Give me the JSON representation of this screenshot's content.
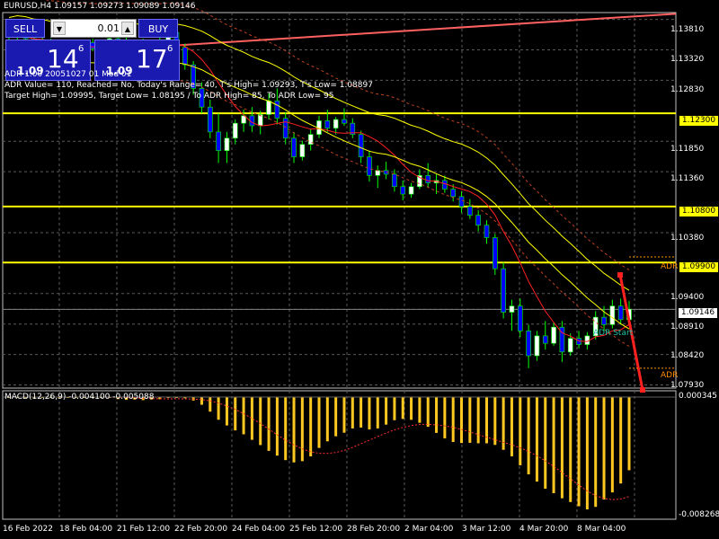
{
  "title": "EURUSD,H4  1.09157 1.09273 1.09089 1.09146",
  "trade_panel": {
    "sell_label": "SELL",
    "buy_label": "BUY",
    "lot_value": "0.01",
    "bid_prefix": "1.09",
    "bid_big": "14",
    "bid_sup": "6",
    "ask_prefix": "1.09",
    "ask_big": "17",
    "ask_sup": "6"
  },
  "info_lines": [
    "ADR 1.00 20051027 01 Mod 01",
    "ADR Value= 110, Reached= No, Today's Range= 40, T's High= 1.09293, T's Low= 1.08897",
    "Target High= 1.09995, Target Low= 1.08195 / To ADR High= 85, To ADR Low= 95"
  ],
  "price_axis": [
    "1.13810",
    "1.13320",
    "1.12830",
    "1.12300",
    "1.11850",
    "1.11360",
    "1.10800",
    "1.10380",
    "1.09900",
    "1.09400",
    "1.09146",
    "1.08910",
    "1.08420",
    "1.07930"
  ],
  "highlight_levels": [
    "1.12300",
    "1.10800",
    "1.09900"
  ],
  "current_price": "1.09146",
  "labels": {
    "adr_start": "ADR Start",
    "adr_high": "ADR",
    "adr_low": "ADR"
  },
  "macd": {
    "title": "MACD(12,26,9) -0.004100 -0.005088",
    "axis_top": "0.000345",
    "axis_bottom": "-0.008268"
  },
  "time_axis": [
    "16 Feb 2022",
    "18 Feb 04:00",
    "21 Feb 12:00",
    "22 Feb 20:00",
    "24 Feb 04:00",
    "25 Feb 12:00",
    "28 Feb 20:00",
    "2 Mar 04:00",
    "3 Mar 12:00",
    "4 Mar 20:00",
    "8 Mar 04:00"
  ],
  "colors": {
    "background": "#000000",
    "grid": "#5a5a5a",
    "bull_candle": "#ffffff",
    "bear_candle": "#0000ff",
    "wick": "#00ff00",
    "level_line": "#ffff00",
    "macd_bar": "#ffc820",
    "envelope": "#ffff00",
    "ma_red": "#ff2020",
    "dotted": "#c04020"
  },
  "candles": [
    [
      1.1362,
      1.137,
      1.1348,
      1.1352
    ],
    [
      1.1352,
      1.1362,
      1.134,
      1.1358
    ],
    [
      1.1358,
      1.1366,
      1.1345,
      1.135
    ],
    [
      1.135,
      1.1356,
      1.133,
      1.1338
    ],
    [
      1.1338,
      1.1352,
      1.1332,
      1.1346
    ],
    [
      1.1346,
      1.135,
      1.1325,
      1.1332
    ],
    [
      1.1332,
      1.1345,
      1.132,
      1.134
    ],
    [
      1.134,
      1.1344,
      1.1318,
      1.1324
    ],
    [
      1.1324,
      1.1342,
      1.132,
      1.1336
    ],
    [
      1.1336,
      1.1348,
      1.1326,
      1.1344
    ],
    [
      1.1344,
      1.135,
      1.133,
      1.1334
    ],
    [
      1.1334,
      1.1346,
      1.1328,
      1.1342
    ],
    [
      1.1342,
      1.1356,
      1.1336,
      1.135
    ],
    [
      1.135,
      1.1358,
      1.134,
      1.1344
    ],
    [
      1.1344,
      1.1354,
      1.133,
      1.1336
    ],
    [
      1.1336,
      1.1346,
      1.1326,
      1.1342
    ],
    [
      1.1342,
      1.135,
      1.1328,
      1.1332
    ],
    [
      1.1332,
      1.1342,
      1.132,
      1.1338
    ],
    [
      1.1338,
      1.1354,
      1.1332,
      1.1348
    ],
    [
      1.1348,
      1.1366,
      1.134,
      1.136
    ],
    [
      1.136,
      1.1368,
      1.133,
      1.1336
    ],
    [
      1.1336,
      1.1342,
      1.13,
      1.1308
    ],
    [
      1.1308,
      1.1314,
      1.126,
      1.127
    ],
    [
      1.127,
      1.128,
      1.123,
      1.124
    ],
    [
      1.124,
      1.1252,
      1.119,
      1.12
    ],
    [
      1.12,
      1.123,
      1.115,
      1.117
    ],
    [
      1.117,
      1.12,
      1.115,
      1.119
    ],
    [
      1.119,
      1.122,
      1.118,
      1.1214
    ],
    [
      1.1214,
      1.1236,
      1.12,
      1.1226
    ],
    [
      1.1226,
      1.124,
      1.12,
      1.121
    ],
    [
      1.121,
      1.1234,
      1.1196,
      1.1228
    ],
    [
      1.1228,
      1.1262,
      1.122,
      1.125
    ],
    [
      1.125,
      1.127,
      1.1212,
      1.1222
    ],
    [
      1.1222,
      1.1232,
      1.118,
      1.119
    ],
    [
      1.119,
      1.12,
      1.115,
      1.116
    ],
    [
      1.116,
      1.1186,
      1.1154,
      1.118
    ],
    [
      1.118,
      1.1205,
      1.117,
      1.1196
    ],
    [
      1.1196,
      1.1226,
      1.119,
      1.1218
    ],
    [
      1.1218,
      1.1236,
      1.12,
      1.1206
    ],
    [
      1.1206,
      1.1224,
      1.1196,
      1.122
    ],
    [
      1.122,
      1.1238,
      1.121,
      1.1214
    ],
    [
      1.1214,
      1.1222,
      1.119,
      1.1196
    ],
    [
      1.1196,
      1.1202,
      1.115,
      1.116
    ],
    [
      1.116,
      1.117,
      1.112,
      1.113
    ],
    [
      1.113,
      1.1146,
      1.111,
      1.1138
    ],
    [
      1.1138,
      1.1152,
      1.1124,
      1.1132
    ],
    [
      1.1132,
      1.114,
      1.1104,
      1.1112
    ],
    [
      1.1112,
      1.1122,
      1.109,
      1.11
    ],
    [
      1.11,
      1.1118,
      1.1094,
      1.1112
    ],
    [
      1.1112,
      1.114,
      1.1108,
      1.113
    ],
    [
      1.113,
      1.115,
      1.111,
      1.1118
    ],
    [
      1.1118,
      1.1132,
      1.11,
      1.1122
    ],
    [
      1.1122,
      1.113,
      1.1102,
      1.1108
    ],
    [
      1.1108,
      1.1116,
      1.1088,
      1.1096
    ],
    [
      1.1096,
      1.1104,
      1.107,
      1.108
    ],
    [
      1.108,
      1.1092,
      1.106,
      1.1066
    ],
    [
      1.1066,
      1.1074,
      1.104,
      1.105
    ],
    [
      1.105,
      1.1058,
      1.102,
      1.103
    ],
    [
      1.103,
      1.1036,
      1.097,
      1.098
    ],
    [
      1.098,
      1.099,
      1.09,
      1.091
    ],
    [
      1.091,
      1.093,
      1.088,
      1.092
    ],
    [
      1.092,
      1.0932,
      1.087,
      1.088
    ],
    [
      1.088,
      1.089,
      1.082,
      1.084
    ],
    [
      1.084,
      1.088,
      1.0832,
      1.0872
    ],
    [
      1.0872,
      1.0896,
      1.085,
      1.086
    ],
    [
      1.086,
      1.0894,
      1.0856,
      1.0886
    ],
    [
      1.0886,
      1.0896,
      1.083,
      1.0846
    ],
    [
      1.0846,
      1.0876,
      1.084,
      1.0868
    ],
    [
      1.0868,
      1.088,
      1.0852,
      1.0858
    ],
    [
      1.0858,
      1.0878,
      1.085,
      1.0872
    ],
    [
      1.0872,
      1.0912,
      1.0866,
      1.0902
    ],
    [
      1.0902,
      1.092,
      1.088,
      1.089
    ],
    [
      1.089,
      1.093,
      1.0884,
      1.092
    ],
    [
      1.092,
      1.0932,
      1.089,
      1.0898
    ],
    [
      1.0898,
      1.0928,
      1.089,
      1.0915
    ]
  ]
}
